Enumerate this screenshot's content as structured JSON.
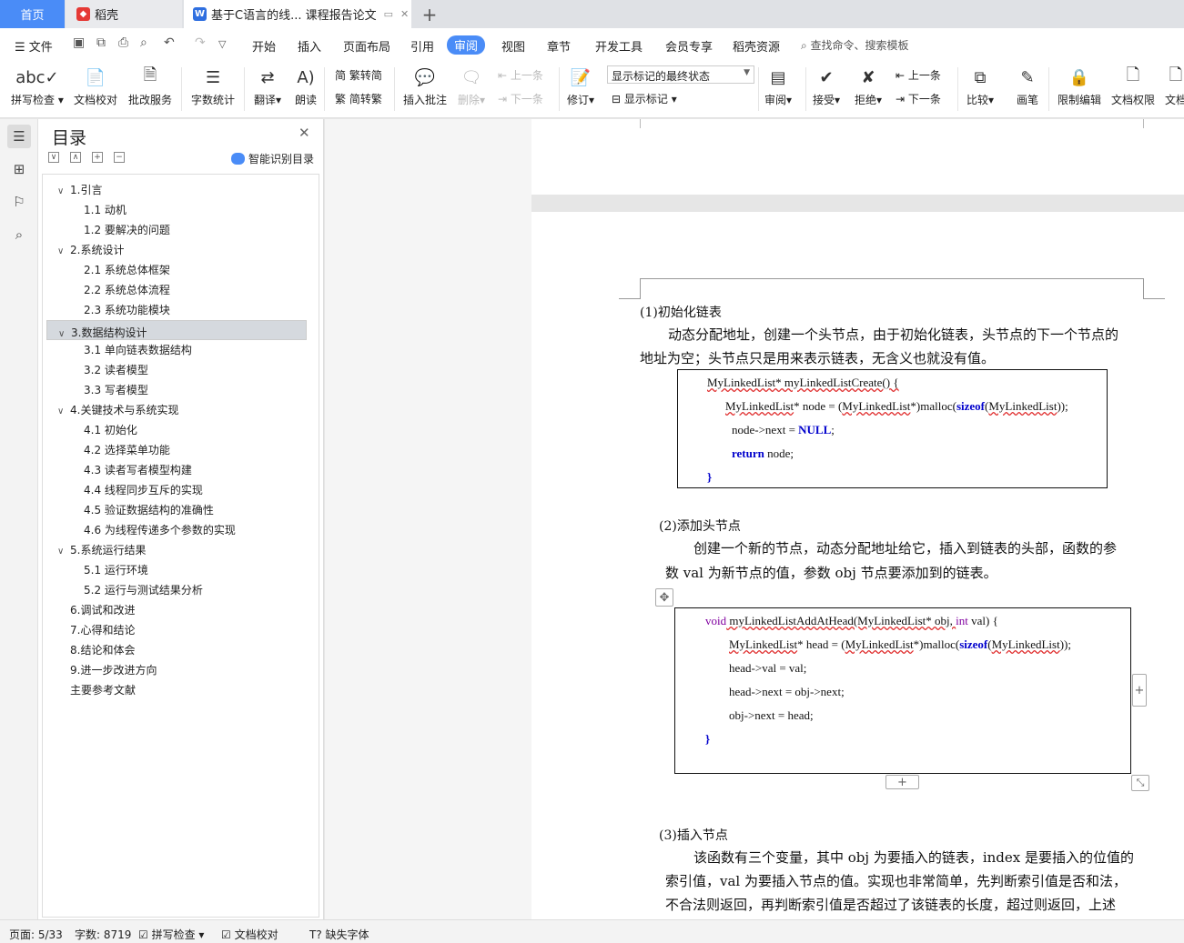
{
  "tabs": {
    "home": "首页",
    "daoke": "稻壳",
    "doc": "基于C语言的线... 课程报告论文"
  },
  "menu": {
    "file": "文件",
    "items": [
      "开始",
      "插入",
      "页面布局",
      "引用",
      "审阅",
      "视图",
      "章节",
      "开发工具",
      "会员专享",
      "稻壳资源"
    ],
    "active": "审阅",
    "search": "查找命令、搜索模板"
  },
  "toolbar": {
    "spellcheck": "拼写检查",
    "doccheck": "文档校对",
    "review_service": "批改服务",
    "wordcount": "字数统计",
    "translate": "翻译",
    "read_aloud": "朗读",
    "trad_to_simp": "繁转简",
    "simp_to_trad": "简转繁",
    "insert_comment": "插入批注",
    "delete": "删除",
    "prev_comment": "上一条",
    "next_comment": "下一条",
    "track_changes": "修订",
    "markup_select": "显示标记的最终状态",
    "show_markup": "显示标记",
    "review": "审阅",
    "accept": "接受",
    "reject": "拒绝",
    "prev_change": "上一条",
    "next_change": "下一条",
    "compare": "比较",
    "pen": "画笔",
    "restrict_edit": "限制编辑",
    "doc_permission": "文档权限",
    "doc_more": "文档"
  },
  "toc": {
    "title": "目录",
    "smart": "智能识别目录",
    "items": [
      {
        "label": "1.引言",
        "level": 1,
        "chev": "∨"
      },
      {
        "label": "1.1 动机",
        "level": 2
      },
      {
        "label": "1.2  要解决的问题",
        "level": 2
      },
      {
        "label": "2.系统设计",
        "level": 1,
        "chev": "∨"
      },
      {
        "label": "2.1 系统总体框架",
        "level": 2
      },
      {
        "label": "2.2  系统总体流程",
        "level": 2
      },
      {
        "label": "2.3  系统功能模块",
        "level": 2
      },
      {
        "label": "3.数据结构设计",
        "level": 1,
        "chev": "∨",
        "selected": true
      },
      {
        "label": "3.1 单向链表数据结构",
        "level": 2
      },
      {
        "label": "3.2 读者模型",
        "level": 2
      },
      {
        "label": "3.3 写者模型",
        "level": 2
      },
      {
        "label": "4.关键技术与系统实现",
        "level": 1,
        "chev": "∨"
      },
      {
        "label": "4.1 初始化",
        "level": 2
      },
      {
        "label": "4.2 选择菜单功能",
        "level": 2
      },
      {
        "label": "4.3 读者写者模型构建",
        "level": 2
      },
      {
        "label": "4.4 线程同步互斥的实现",
        "level": 2
      },
      {
        "label": "4.5 验证数据结构的准确性",
        "level": 2
      },
      {
        "label": "4.6 为线程传递多个参数的实现",
        "level": 2
      },
      {
        "label": "5.系统运行结果",
        "level": 1,
        "chev": "∨"
      },
      {
        "label": "5.1 运行环境",
        "level": 2
      },
      {
        "label": "5.2 运行与测试结果分析",
        "level": 2
      },
      {
        "label": "6.调试和改进",
        "level": 1
      },
      {
        "label": "7.心得和结论",
        "level": 1
      },
      {
        "label": "8.结论和体会",
        "level": 1
      },
      {
        "label": "9.进一步改进方向",
        "level": 1
      },
      {
        "label": "主要参考文献",
        "level": 1
      }
    ]
  },
  "doc": {
    "s1_heading": "(1)初始化链表",
    "s1_line1": "动态分配地址，创建一个头节点，由于初始化链表，头节点的下一个节点的",
    "s1_line2": "地址为空；头节点只是用来表示链表，无含义也就没有值。",
    "code1": {
      "l1a": "MyLinkedList* myLinkedListCreate() {",
      "l2a": "MyLinkedList",
      "l2b": "* node = (",
      "l2c": "MyLinkedList",
      "l2d": "*)malloc(",
      "l2e": "sizeof",
      "l2f": "(",
      "l2g": "MyLinkedList",
      "l2h": "));",
      "l3a": "node->next = ",
      "l3b": "NULL",
      "l3c": ";",
      "l4a": "return",
      "l4b": " node;",
      "l5": "}"
    },
    "s2_heading": "(2)添加头节点",
    "s2_line1": "创建一个新的节点，动态分配地址给它，插入到链表的头部，函数的参",
    "s2_line2": "数 val 为新节点的值，参数 obj 节点要添加到的链表。",
    "code2": {
      "l1a": "void",
      "l1b": " myLinkedListAddAtHead(MyLinkedList* obj, ",
      "l1c": "int",
      "l1d": " val) {",
      "l2a": "MyLinkedList",
      "l2b": "* head = (",
      "l2c": "MyLinkedList",
      "l2d": "*)malloc(",
      "l2e": "sizeof",
      "l2f": "(",
      "l2g": "MyLinkedList",
      "l2h": "));",
      "l3": "head->val = val;",
      "l4": "head->next = obj->next;",
      "l5": "obj->next = head;",
      "l6": "}"
    },
    "s3_heading": "(3)插入节点",
    "s3_line1": "该函数有三个变量，其中 obj 为要插入的链表，index 是要插入的位值的",
    "s3_line2": "索引值，val 为要插入节点的值。实现也非常简单，先判断索引值是否和法，",
    "s3_line3": "不合法则返回，再判断索引值是否超过了该链表的长度，超过则返回，上述"
  },
  "status": {
    "page": "页面: 5/33",
    "words": "字数: 8719",
    "spell": "拼写检查",
    "proof": "文档校对",
    "missing_font": "缺失字体"
  },
  "colors": {
    "accent": "#4a8cf7",
    "keyword": "#0000cc",
    "type_keyword": "#8000a0"
  }
}
